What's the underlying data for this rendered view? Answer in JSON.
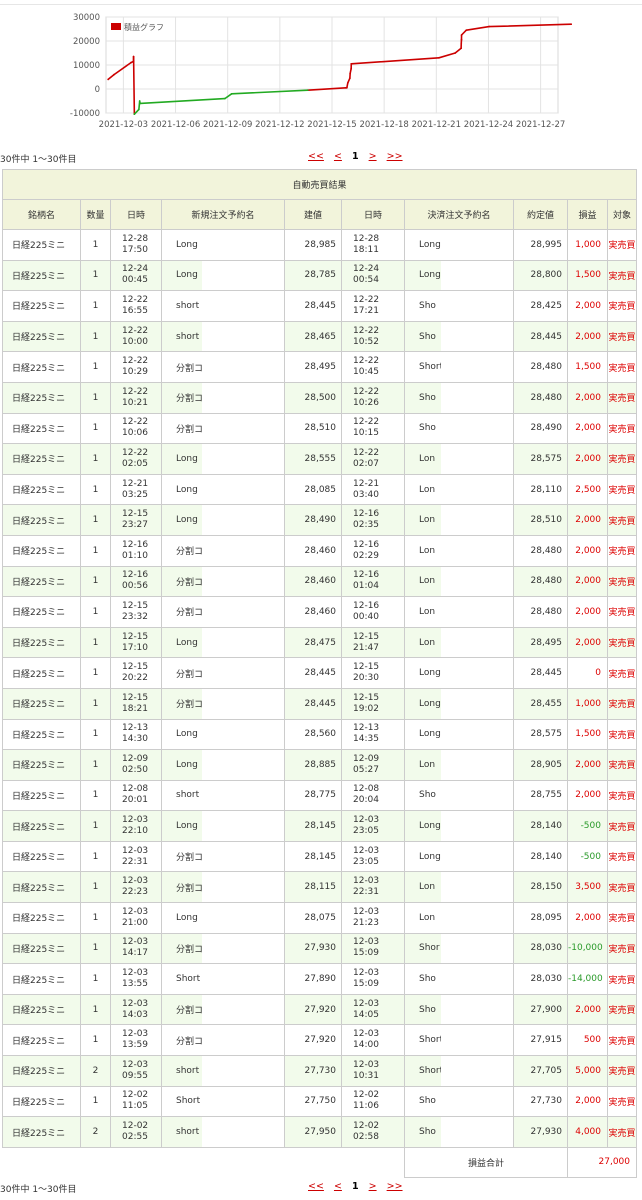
{
  "chart_data": {
    "type": "line",
    "legend_label": "積益グラフ",
    "legend_color": "#cc0000",
    "y_ticks": [
      "30000",
      "20000",
      "10000",
      "0",
      "-10000"
    ],
    "ylim": [
      -10000,
      30000
    ],
    "x_ticks": [
      "2021-12-03",
      "2021-12-06",
      "2021-12-09",
      "2021-12-12",
      "2021-12-15",
      "2021-12-18",
      "2021-12-21",
      "2021-12-24",
      "2021-12-27"
    ],
    "xlim": [
      "2021-12-02",
      "2021-12-28"
    ],
    "positive_color": "#cc0000",
    "negative_color": "#22aa22",
    "points": [
      {
        "x": "2021-12-02 02:58",
        "y": 4000
      },
      {
        "x": "2021-12-02 11:06",
        "y": 6000
      },
      {
        "x": "2021-12-03 10:31",
        "y": 11000
      },
      {
        "x": "2021-12-03 14:00",
        "y": 11500
      },
      {
        "x": "2021-12-03 14:05",
        "y": 13500
      },
      {
        "x": "2021-12-03 15:09",
        "y": -10500
      },
      {
        "x": "2021-12-03 21:23",
        "y": -8500
      },
      {
        "x": "2021-12-03 22:31",
        "y": -5000
      },
      {
        "x": "2021-12-03 23:05",
        "y": -6000
      },
      {
        "x": "2021-12-08 20:04",
        "y": -4000
      },
      {
        "x": "2021-12-09 05:27",
        "y": -2000
      },
      {
        "x": "2021-12-13 14:35",
        "y": -500
      },
      {
        "x": "2021-12-15 19:02",
        "y": 500
      },
      {
        "x": "2021-12-15 20:30",
        "y": 500
      },
      {
        "x": "2021-12-15 21:47",
        "y": 2500
      },
      {
        "x": "2021-12-16 00:40",
        "y": 4500
      },
      {
        "x": "2021-12-16 01:04",
        "y": 6500
      },
      {
        "x": "2021-12-16 02:29",
        "y": 8500
      },
      {
        "x": "2021-12-16 02:35",
        "y": 10500
      },
      {
        "x": "2021-12-21 03:40",
        "y": 13000
      },
      {
        "x": "2021-12-22 02:07",
        "y": 15000
      },
      {
        "x": "2021-12-22 10:15",
        "y": 17000
      },
      {
        "x": "2021-12-22 10:26",
        "y": 19000
      },
      {
        "x": "2021-12-22 10:45",
        "y": 20500
      },
      {
        "x": "2021-12-22 10:52",
        "y": 22500
      },
      {
        "x": "2021-12-22 17:21",
        "y": 24500
      },
      {
        "x": "2021-12-24 00:54",
        "y": 26000
      },
      {
        "x": "2021-12-28 18:11",
        "y": 27000
      }
    ]
  },
  "pager": {
    "count_text": "30件中 1〜30件目",
    "first": "<<",
    "prev": "<",
    "current": "1",
    "next": ">",
    "last": ">>"
  },
  "table": {
    "title": "自動売買結果",
    "headers": [
      "銘柄名",
      "数量",
      "日時",
      "新規注文予約名",
      "建値",
      "日時",
      "決済注文予約名",
      "約定値",
      "損益",
      "対象"
    ],
    "rows": [
      {
        "name": "日経225ミニ",
        "qty": "1",
        "open_date": "12-28",
        "open_time": "17:50",
        "open_order": "Long",
        "open_price": "28,985",
        "close_date": "12-28",
        "close_time": "18:11",
        "close_order": "Long",
        "close_price": "28,995",
        "pl": "1,000",
        "target": "実売買"
      },
      {
        "name": "日経225ミニ",
        "qty": "1",
        "open_date": "12-24",
        "open_time": "00:45",
        "open_order": "Long",
        "open_price": "28,785",
        "close_date": "12-24",
        "close_time": "00:54",
        "close_order": "Long",
        "close_price": "28,800",
        "pl": "1,500",
        "target": "実売買"
      },
      {
        "name": "日経225ミニ",
        "qty": "1",
        "open_date": "12-22",
        "open_time": "16:55",
        "open_order": "short",
        "open_price": "28,445",
        "close_date": "12-22",
        "close_time": "17:21",
        "close_order": "Sho",
        "close_price": "28,425",
        "pl": "2,000",
        "target": "実売買"
      },
      {
        "name": "日経225ミニ",
        "qty": "1",
        "open_date": "12-22",
        "open_time": "10:00",
        "open_order": "short",
        "open_price": "28,465",
        "close_date": "12-22",
        "close_time": "10:52",
        "close_order": "Sho",
        "close_price": "28,445",
        "pl": "2,000",
        "target": "実売買"
      },
      {
        "name": "日経225ミニ",
        "qty": "1",
        "open_date": "12-22",
        "open_time": "10:29",
        "open_order": "分割コ",
        "open_price": "28,495",
        "close_date": "12-22",
        "close_time": "10:45",
        "close_order": "Short",
        "close_price": "28,480",
        "pl": "1,500",
        "target": "実売買"
      },
      {
        "name": "日経225ミニ",
        "qty": "1",
        "open_date": "12-22",
        "open_time": "10:21",
        "open_order": "分割コ",
        "open_price": "28,500",
        "close_date": "12-22",
        "close_time": "10:26",
        "close_order": "Sho",
        "close_price": "28,480",
        "pl": "2,000",
        "target": "実売買"
      },
      {
        "name": "日経225ミニ",
        "qty": "1",
        "open_date": "12-22",
        "open_time": "10:06",
        "open_order": "分割コ",
        "open_price": "28,510",
        "close_date": "12-22",
        "close_time": "10:15",
        "close_order": "Sho",
        "close_price": "28,490",
        "pl": "2,000",
        "target": "実売買"
      },
      {
        "name": "日経225ミニ",
        "qty": "1",
        "open_date": "12-22",
        "open_time": "02:05",
        "open_order": "Long",
        "open_price": "28,555",
        "close_date": "12-22",
        "close_time": "02:07",
        "close_order": "Lon",
        "close_price": "28,575",
        "pl": "2,000",
        "target": "実売買"
      },
      {
        "name": "日経225ミニ",
        "qty": "1",
        "open_date": "12-21",
        "open_time": "03:25",
        "open_order": "Long",
        "open_price": "28,085",
        "close_date": "12-21",
        "close_time": "03:40",
        "close_order": "Lon",
        "close_price": "28,110",
        "pl": "2,500",
        "target": "実売買"
      },
      {
        "name": "日経225ミニ",
        "qty": "1",
        "open_date": "12-15",
        "open_time": "23:27",
        "open_order": "Long",
        "open_price": "28,490",
        "close_date": "12-16",
        "close_time": "02:35",
        "close_order": "Lon",
        "close_price": "28,510",
        "pl": "2,000",
        "target": "実売買"
      },
      {
        "name": "日経225ミニ",
        "qty": "1",
        "open_date": "12-16",
        "open_time": "01:10",
        "open_order": "分割コ",
        "open_price": "28,460",
        "close_date": "12-16",
        "close_time": "02:29",
        "close_order": "Lon",
        "close_price": "28,480",
        "pl": "2,000",
        "target": "実売買"
      },
      {
        "name": "日経225ミニ",
        "qty": "1",
        "open_date": "12-16",
        "open_time": "00:56",
        "open_order": "分割コ",
        "open_price": "28,460",
        "close_date": "12-16",
        "close_time": "01:04",
        "close_order": "Lon",
        "close_price": "28,480",
        "pl": "2,000",
        "target": "実売買"
      },
      {
        "name": "日経225ミニ",
        "qty": "1",
        "open_date": "12-15",
        "open_time": "23:32",
        "open_order": "分割コ",
        "open_price": "28,460",
        "close_date": "12-16",
        "close_time": "00:40",
        "close_order": "Lon",
        "close_price": "28,480",
        "pl": "2,000",
        "target": "実売買"
      },
      {
        "name": "日経225ミニ",
        "qty": "1",
        "open_date": "12-15",
        "open_time": "17:10",
        "open_order": "Long",
        "open_price": "28,475",
        "close_date": "12-15",
        "close_time": "21:47",
        "close_order": "Lon",
        "close_price": "28,495",
        "pl": "2,000",
        "target": "実売買"
      },
      {
        "name": "日経225ミニ",
        "qty": "1",
        "open_date": "12-15",
        "open_time": "20:22",
        "open_order": "分割コ",
        "open_price": "28,445",
        "close_date": "12-15",
        "close_time": "20:30",
        "close_order": "Long",
        "close_price": "28,445",
        "pl": "0",
        "target": "実売買"
      },
      {
        "name": "日経225ミニ",
        "qty": "1",
        "open_date": "12-15",
        "open_time": "18:21",
        "open_order": "分割コ",
        "open_price": "28,445",
        "close_date": "12-15",
        "close_time": "19:02",
        "close_order": "Long",
        "close_price": "28,455",
        "pl": "1,000",
        "target": "実売買"
      },
      {
        "name": "日経225ミニ",
        "qty": "1",
        "open_date": "12-13",
        "open_time": "14:30",
        "open_order": "Long",
        "open_price": "28,560",
        "close_date": "12-13",
        "close_time": "14:35",
        "close_order": "Long",
        "close_price": "28,575",
        "pl": "1,500",
        "target": "実売買"
      },
      {
        "name": "日経225ミニ",
        "qty": "1",
        "open_date": "12-09",
        "open_time": "02:50",
        "open_order": "Long",
        "open_price": "28,885",
        "close_date": "12-09",
        "close_time": "05:27",
        "close_order": "Lon",
        "close_price": "28,905",
        "pl": "2,000",
        "target": "実売買"
      },
      {
        "name": "日経225ミニ",
        "qty": "1",
        "open_date": "12-08",
        "open_time": "20:01",
        "open_order": "short",
        "open_price": "28,775",
        "close_date": "12-08",
        "close_time": "20:04",
        "close_order": "Sho",
        "close_price": "28,755",
        "pl": "2,000",
        "target": "実売買"
      },
      {
        "name": "日経225ミニ",
        "qty": "1",
        "open_date": "12-03",
        "open_time": "22:10",
        "open_order": "Long",
        "open_price": "28,145",
        "close_date": "12-03",
        "close_time": "23:05",
        "close_order": "Long",
        "close_price": "28,140",
        "pl": "-500",
        "target": "実売買",
        "neg": true
      },
      {
        "name": "日経225ミニ",
        "qty": "1",
        "open_date": "12-03",
        "open_time": "22:31",
        "open_order": "分割コ",
        "open_price": "28,145",
        "close_date": "12-03",
        "close_time": "23:05",
        "close_order": "Long",
        "close_price": "28,140",
        "pl": "-500",
        "target": "実売買",
        "neg": true
      },
      {
        "name": "日経225ミニ",
        "qty": "1",
        "open_date": "12-03",
        "open_time": "22:23",
        "open_order": "分割コ",
        "open_price": "28,115",
        "close_date": "12-03",
        "close_time": "22:31",
        "close_order": "Lon",
        "close_price": "28,150",
        "pl": "3,500",
        "target": "実売買"
      },
      {
        "name": "日経225ミニ",
        "qty": "1",
        "open_date": "12-03",
        "open_time": "21:00",
        "open_order": "Long",
        "open_price": "28,075",
        "close_date": "12-03",
        "close_time": "21:23",
        "close_order": "Lon",
        "close_price": "28,095",
        "pl": "2,000",
        "target": "実売買"
      },
      {
        "name": "日経225ミニ",
        "qty": "1",
        "open_date": "12-03",
        "open_time": "14:17",
        "open_order": "分割コ",
        "open_price": "27,930",
        "close_date": "12-03",
        "close_time": "15:09",
        "close_order": "Shor",
        "close_price": "28,030",
        "pl": "-10,000",
        "target": "実売買",
        "neg": true
      },
      {
        "name": "日経225ミニ",
        "qty": "1",
        "open_date": "12-03",
        "open_time": "13:55",
        "open_order": "Short",
        "open_price": "27,890",
        "close_date": "12-03",
        "close_time": "15:09",
        "close_order": "Sho",
        "close_price": "28,030",
        "pl": "-14,000",
        "target": "実売買",
        "neg": true
      },
      {
        "name": "日経225ミニ",
        "qty": "1",
        "open_date": "12-03",
        "open_time": "14:03",
        "open_order": "分割コ",
        "open_price": "27,920",
        "close_date": "12-03",
        "close_time": "14:05",
        "close_order": "Sho",
        "close_price": "27,900",
        "pl": "2,000",
        "target": "実売買"
      },
      {
        "name": "日経225ミニ",
        "qty": "1",
        "open_date": "12-03",
        "open_time": "13:59",
        "open_order": "分割コ",
        "open_price": "27,920",
        "close_date": "12-03",
        "close_time": "14:00",
        "close_order": "Short",
        "close_price": "27,915",
        "pl": "500",
        "target": "実売買"
      },
      {
        "name": "日経225ミニ",
        "qty": "2",
        "open_date": "12-03",
        "open_time": "09:55",
        "open_order": "short",
        "open_price": "27,730",
        "close_date": "12-03",
        "close_time": "10:31",
        "close_order": "Short",
        "close_price": "27,705",
        "pl": "5,000",
        "target": "実売買"
      },
      {
        "name": "日経225ミニ",
        "qty": "1",
        "open_date": "12-02",
        "open_time": "11:05",
        "open_order": "Short",
        "open_price": "27,750",
        "close_date": "12-02",
        "close_time": "11:06",
        "close_order": "Sho",
        "close_price": "27,730",
        "pl": "2,000",
        "target": "実売買"
      },
      {
        "name": "日経225ミニ",
        "qty": "2",
        "open_date": "12-02",
        "open_time": "02:55",
        "open_order": "short",
        "open_price": "27,950",
        "close_date": "12-02",
        "close_time": "02:58",
        "close_order": "Sho",
        "close_price": "27,930",
        "pl": "4,000",
        "target": "実売買"
      }
    ],
    "total_label": "損益合計",
    "total_value": "27,000"
  }
}
